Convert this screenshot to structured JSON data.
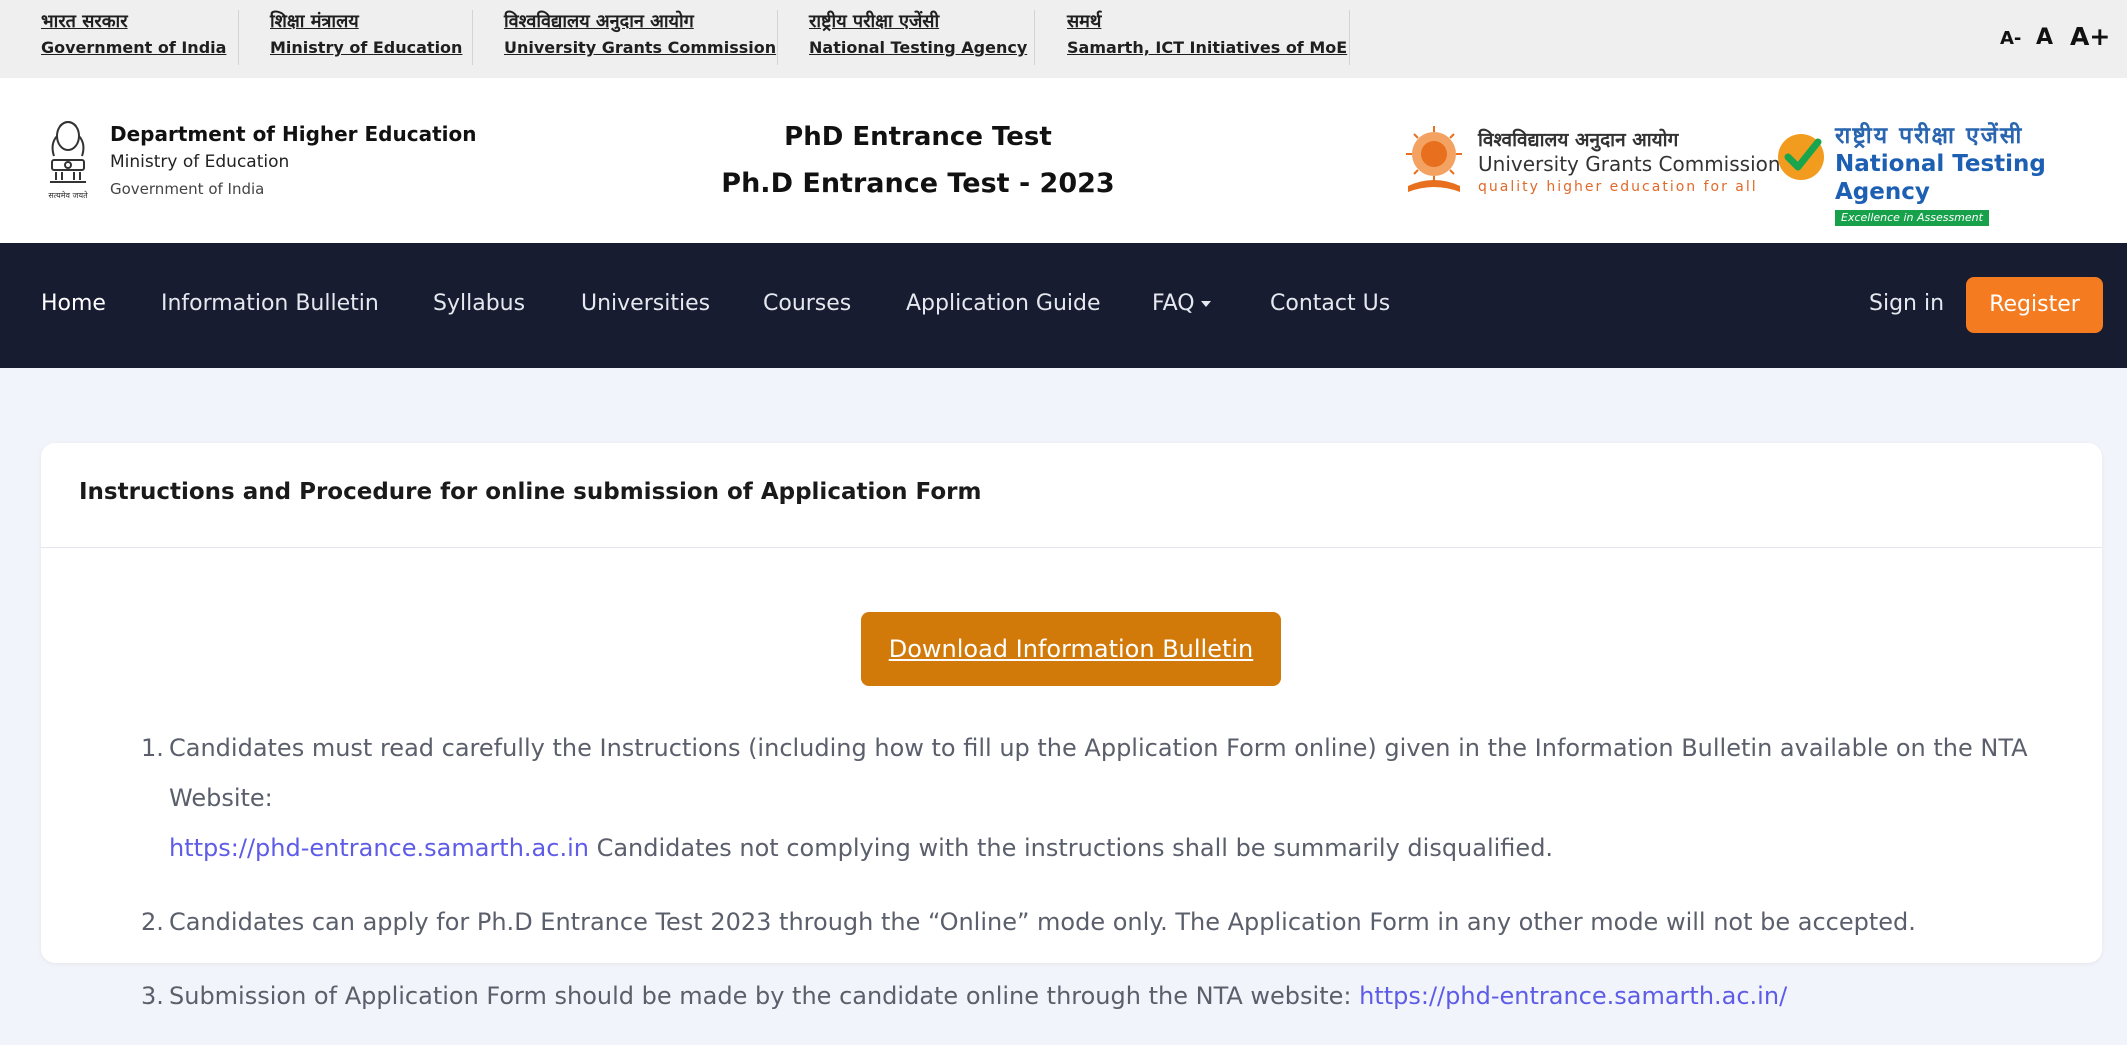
{
  "gov_links": [
    {
      "hi": "भारत सरकार",
      "en": "Government of India"
    },
    {
      "hi": "शिक्षा मंत्रालय",
      "en": "Ministry of Education"
    },
    {
      "hi": "विश्वविद्यालय अनुदान आयोग",
      "en": "University Grants Commission"
    },
    {
      "hi": "राष्ट्रीय परीक्षा एजेंसी",
      "en": "National Testing Agency"
    },
    {
      "hi": "समर्थ",
      "en": "Samarth, ICT Initiatives of MoE"
    }
  ],
  "font_controls": {
    "decrease": "A-",
    "normal": "A",
    "increase": "A+"
  },
  "header": {
    "emblem_caption": "सत्यमेव जयते",
    "dept_title": "Department of Higher Education",
    "dept_sub": "Ministry of Education",
    "dept_gov": "Government of India",
    "title_1": "PhD Entrance Test",
    "title_2": "Ph.D Entrance Test - 2023",
    "ugc": {
      "hi": "विश्वविद्यालय अनुदान आयोग",
      "en": "University Grants Commission",
      "tag": "quality higher education for all"
    },
    "nta": {
      "hi": "राष्ट्रीय परीक्षा एजेंसी",
      "en": "National Testing Agency",
      "tag": "Excellence in Assessment"
    }
  },
  "nav": {
    "items": [
      "Home",
      "Information Bulletin",
      "Syllabus",
      "Universities",
      "Courses",
      "Application Guide",
      "FAQ",
      "Contact Us"
    ],
    "sign_in": "Sign in",
    "register": "Register"
  },
  "card": {
    "title": "Instructions and Procedure for online submission of Application Form",
    "download_label": "Download Information Bulletin",
    "instructions": [
      {
        "num": "1.",
        "text_a": "Candidates must read carefully the Instructions (including how to fill up the Application Form online) given in the Information Bulletin available on the NTA Website:",
        "link": "https://phd-entrance.samarth.ac.in",
        "text_b": " Candidates not complying with the instructions shall be summarily disqualified."
      },
      {
        "num": "2.",
        "text_a": "Candidates can apply for Ph.D Entrance Test 2023 through the “Online” mode only. The Application Form in any other mode will not be accepted."
      },
      {
        "num": "3.",
        "text_a": "Submission of Application Form should be made by the candidate online through the NTA website: ",
        "link": "https://phd-entrance.samarth.ac.in/"
      }
    ]
  },
  "colors": {
    "nav_bg": "#181c31",
    "register_bg": "#f47b20",
    "download_bg": "#d17a0a",
    "link": "#5e5ce6",
    "page_bg": "#f1f4fa"
  }
}
